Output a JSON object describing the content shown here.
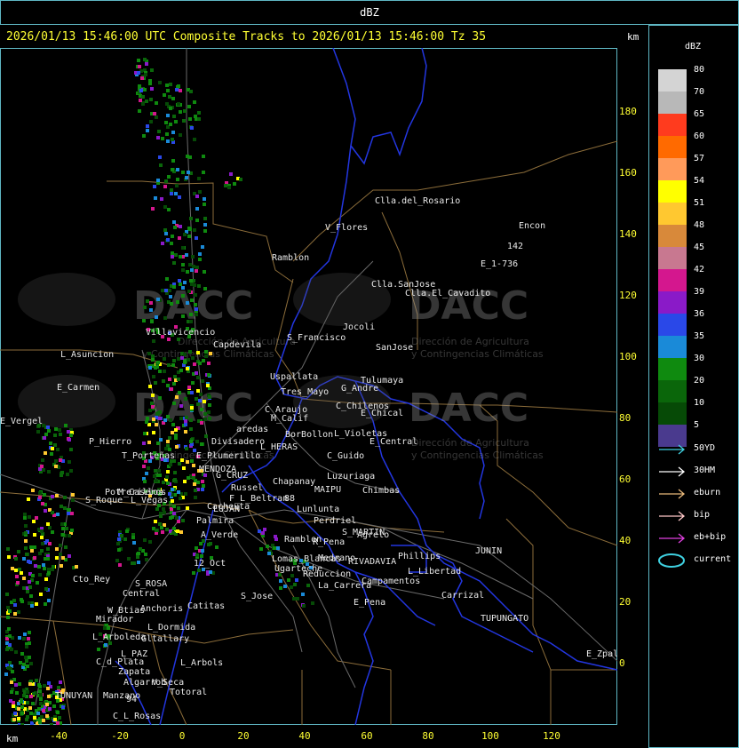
{
  "window": {
    "title": "dBZ"
  },
  "header": {
    "text": "2026/01/13 15:46:00 UTC Composite Tracks to 2026/01/13 15:46:00 Tz 35"
  },
  "axes": {
    "unit_top": "km",
    "unit_bottom": "km",
    "y_ticks": [
      "180",
      "160",
      "140",
      "120",
      "100",
      "80",
      "60",
      "40",
      "20",
      "0"
    ],
    "x_ticks": [
      "-40",
      "-20",
      "0",
      "20",
      "40",
      "60",
      "80",
      "100",
      "120"
    ]
  },
  "legend": {
    "title": "dBZ",
    "scale": [
      {
        "label": "80",
        "color": "#d4d4d4"
      },
      {
        "label": "70",
        "color": "#b8b8b8"
      },
      {
        "label": "65",
        "color": "#ff3b1e"
      },
      {
        "label": "60",
        "color": "#ff6a00"
      },
      {
        "label": "57",
        "color": "#ff9a5a"
      },
      {
        "label": "54",
        "color": "#ffff00"
      },
      {
        "label": "51",
        "color": "#ffc830"
      },
      {
        "label": "48",
        "color": "#d8893a"
      },
      {
        "label": "45",
        "color": "#c87890"
      },
      {
        "label": "42",
        "color": "#d4178e"
      },
      {
        "label": "39",
        "color": "#8a1ac8"
      },
      {
        "label": "36",
        "color": "#2a48e8"
      },
      {
        "label": "35",
        "color": "#1a8ad8"
      },
      {
        "label": "30",
        "color": "#0f8a0f"
      },
      {
        "label": "20",
        "color": "#0a660a"
      },
      {
        "label": "10",
        "color": "#064a06"
      },
      {
        "label": "5",
        "color": "#4a3a8e"
      }
    ],
    "tracks": [
      {
        "label": "50YD",
        "color": "#3fd0e0",
        "type": "arrow"
      },
      {
        "label": "30HM",
        "color": "#ffffff",
        "type": "arrow"
      },
      {
        "label": "eburn",
        "color": "#e8b87a",
        "type": "arrow"
      },
      {
        "label": "bip",
        "color": "#ffc8c8",
        "type": "arrow"
      },
      {
        "label": "eb+bip",
        "color": "#e040e0",
        "type": "arrow"
      },
      {
        "label": "current",
        "color": "#3fd0e0",
        "type": "ellipse"
      }
    ]
  },
  "watermark": {
    "name": "DACC",
    "subtitle1": "Dirección de Agricultura",
    "subtitle2": "y Contingencias Climáticas"
  },
  "places": [
    {
      "name": "Clla.del_Rosario"
    },
    {
      "name": "Encon"
    },
    {
      "name": "142"
    },
    {
      "name": "E_1-736"
    },
    {
      "name": "Ramblon"
    },
    {
      "name": "Clla.SanJose"
    },
    {
      "name": "Clla.El_Cavadito"
    },
    {
      "name": "Villavicencio"
    },
    {
      "name": "Capdevila"
    },
    {
      "name": "S_Francisco"
    },
    {
      "name": "Jocoli"
    },
    {
      "name": "SanJose"
    },
    {
      "name": "L_Asuncion"
    },
    {
      "name": "Uspallata"
    },
    {
      "name": "Tres_Mayo"
    },
    {
      "name": "Tulumaya"
    },
    {
      "name": "G_Andre"
    },
    {
      "name": "E_Carmen"
    },
    {
      "name": "C_Chilenos"
    },
    {
      "name": "C_Araujo"
    },
    {
      "name": "E_Chical"
    },
    {
      "name": "M_Calif"
    },
    {
      "name": "E_Vergel"
    },
    {
      "name": "aredas"
    },
    {
      "name": "BorBollon"
    },
    {
      "name": "L_Violetas"
    },
    {
      "name": "E_Central"
    },
    {
      "name": "Divisadero"
    },
    {
      "name": "L_HERAS"
    },
    {
      "name": "P_Hierro"
    },
    {
      "name": "C_Guido"
    },
    {
      "name": "T_Porteñas"
    },
    {
      "name": "E_Plumerillo"
    },
    {
      "name": "MENDOZA"
    },
    {
      "name": "G_CRUZ"
    },
    {
      "name": "Luzuriaga"
    },
    {
      "name": "Chapanay"
    },
    {
      "name": "F_L_Beltran"
    },
    {
      "name": "Russel"
    },
    {
      "name": "MAIPU"
    },
    {
      "name": "Chimbas"
    },
    {
      "name": "M_Caseros"
    },
    {
      "name": "Potrerillos"
    },
    {
      "name": "88"
    },
    {
      "name": "S_Roque"
    },
    {
      "name": "L_Vegas"
    },
    {
      "name": "Cacheuta"
    },
    {
      "name": "LUJAN"
    },
    {
      "name": "Lunlunta"
    },
    {
      "name": "Palmira"
    },
    {
      "name": "Perdriel"
    },
    {
      "name": "S_MARTIN"
    },
    {
      "name": "A_Verde"
    },
    {
      "name": "Agrelo"
    },
    {
      "name": "Ramblon"
    },
    {
      "name": "R_Pena"
    },
    {
      "name": "JUNIN"
    },
    {
      "name": "Lomas_Blancas"
    },
    {
      "name": "Medrano"
    },
    {
      "name": "RIVADAVIA"
    },
    {
      "name": "Phillips"
    },
    {
      "name": "12_Oct"
    },
    {
      "name": "Ugarteche"
    },
    {
      "name": "Reduccion"
    },
    {
      "name": "L_Libertad"
    },
    {
      "name": "S_ROSA"
    },
    {
      "name": "Cto_Rey"
    },
    {
      "name": "La_Carrera"
    },
    {
      "name": "Campamentos"
    },
    {
      "name": "Central"
    },
    {
      "name": "S_Jose"
    },
    {
      "name": "Carrizal"
    },
    {
      "name": "Catitas"
    },
    {
      "name": "Anchoris"
    },
    {
      "name": "W_Btias"
    },
    {
      "name": "E_Pena"
    },
    {
      "name": "Mirador"
    },
    {
      "name": "TUPUNGATO"
    },
    {
      "name": "L_Dormida"
    },
    {
      "name": "L_Arboleda"
    },
    {
      "name": "Gltallary"
    },
    {
      "name": "E_Zpal"
    },
    {
      "name": "L_PAZ"
    },
    {
      "name": "C_d_Plata"
    },
    {
      "name": "L_Arbols"
    },
    {
      "name": "Zapata"
    },
    {
      "name": "Algarrob"
    },
    {
      "name": "V_Seca"
    },
    {
      "name": "Totoral"
    },
    {
      "name": "TUNUYAN"
    },
    {
      "name": "Manzano"
    },
    {
      "name": "94"
    },
    {
      "name": "C_L_Rosas"
    },
    {
      "name": "V_Flores"
    },
    {
      "name": "40"
    }
  ]
}
